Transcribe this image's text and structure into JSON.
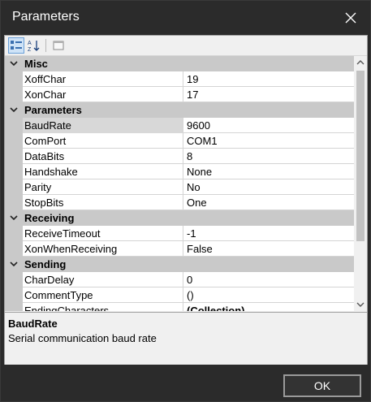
{
  "window": {
    "title": "Parameters"
  },
  "toolbar": {
    "categorized_icon": "categorized-view-icon",
    "alphabetical_icon": "alphabetical-sort-icon",
    "pages_icon": "property-pages-icon"
  },
  "categories": [
    {
      "name": "Misc",
      "props": [
        {
          "name": "XoffChar",
          "value": "19"
        },
        {
          "name": "XonChar",
          "value": "17"
        }
      ]
    },
    {
      "name": "Parameters",
      "props": [
        {
          "name": "BaudRate",
          "value": "9600",
          "selected": true
        },
        {
          "name": "ComPort",
          "value": "COM1"
        },
        {
          "name": "DataBits",
          "value": "8"
        },
        {
          "name": "Handshake",
          "value": "None"
        },
        {
          "name": "Parity",
          "value": "No"
        },
        {
          "name": "StopBits",
          "value": "One"
        }
      ]
    },
    {
      "name": "Receiving",
      "props": [
        {
          "name": "ReceiveTimeout",
          "value": "-1"
        },
        {
          "name": "XonWhenReceiving",
          "value": "False"
        }
      ]
    },
    {
      "name": "Sending",
      "props": [
        {
          "name": "CharDelay",
          "value": "0"
        },
        {
          "name": "CommentType",
          "value": "()"
        },
        {
          "name": "EndingCharacters",
          "value": "(Collection)",
          "bold": true
        }
      ]
    }
  ],
  "help": {
    "title": "BaudRate",
    "description": "Serial communication baud rate"
  },
  "buttons": {
    "ok": "OK"
  },
  "colors": {
    "titlebar": "#2b2b2b",
    "category_bg": "#c9c9c9",
    "selection": "#d8d8d8"
  }
}
